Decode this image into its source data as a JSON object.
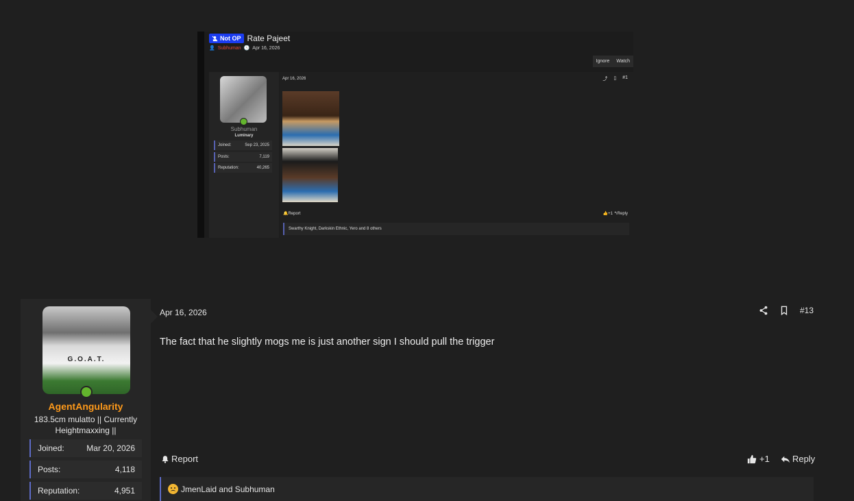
{
  "quoted_screenshot": {
    "badge_label": "Not OP",
    "thread_title": "Rate Pajeet",
    "author": "Subhuman",
    "date": "Apr 16, 2026",
    "buttons": [
      "Ignore",
      "Watch"
    ],
    "user": {
      "name": "Subhuman",
      "rank": "Luminary",
      "joined_label": "Joined:",
      "joined_value": "Sep 23, 2025",
      "posts_label": "Posts:",
      "posts_value": "7,119",
      "reputation_label": "Reputation:",
      "reputation_value": "40,265"
    },
    "post_date": "Apr 16, 2026",
    "post_number": "#1",
    "report_label": "Report",
    "like_label": "+1",
    "reply_label": "Reply",
    "reactions_text": "Swarthy Knight, Darkskin Ethnic, Yero and 8 others"
  },
  "post": {
    "date": "Apr 16, 2026",
    "number": "#13",
    "message": "The fact that he slightly mogs me is just another sign I should pull the trigger",
    "report_label": "Report",
    "like_label": "+1",
    "reply_label": "Reply",
    "reactions_text": "JmenLaid and Subhuman"
  },
  "user": {
    "name": "AgentAngularity",
    "title": "183.5cm mulatto || Currently Heightmaxxing ||",
    "avatar_shirt_text": "G.O.A.T.",
    "joined_label": "Joined:",
    "joined_value": "Mar 20, 2026",
    "posts_label": "Posts:",
    "posts_value": "4,118",
    "reputation_label": "Reputation:",
    "reputation_value": "4,951"
  },
  "colors": {
    "background": "#1f1f1f",
    "panel": "#262626",
    "username": "#ff9a1a",
    "accent_border": "#5d6bc7",
    "online": "#63b52d",
    "badge": "#1b3cf0"
  }
}
